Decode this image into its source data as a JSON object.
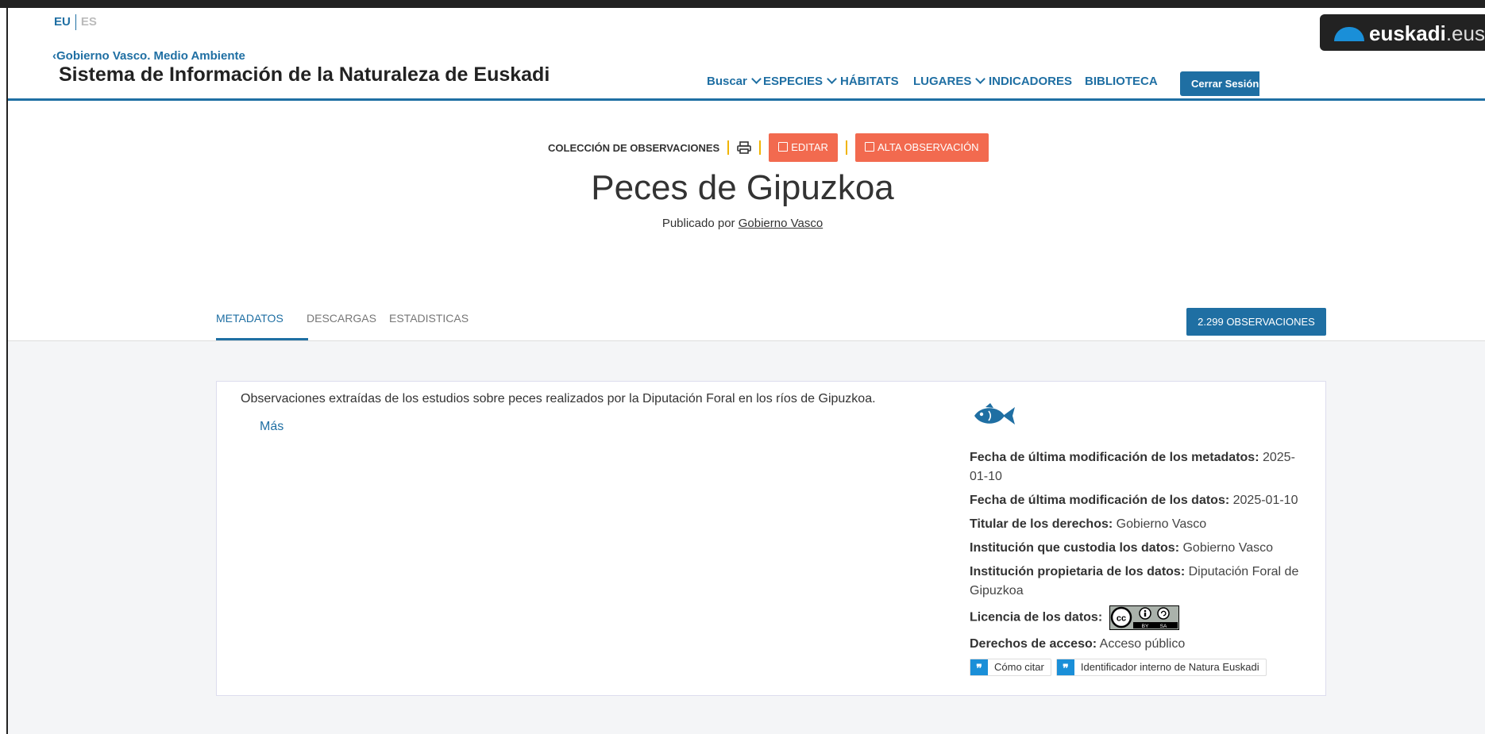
{
  "header": {
    "lang_eu": "EU",
    "lang_es": "ES",
    "gov_link": "Gobierno Vasco. Medio Ambiente",
    "site_title": "Sistema de Información de la Naturaleza de Euskadi",
    "brand_bold": "euskadi",
    "brand_light": ".eus",
    "nav": {
      "buscar": "Buscar",
      "especies": "ESPECIES",
      "habitats": "HÁBITATS",
      "lugares": "LUGARES",
      "indicadores": "INDICADORES",
      "biblioteca": "BIBLIOTECA"
    },
    "logout": "Cerrar Sesión"
  },
  "actions": {
    "collection_label": "COLECCIÓN DE OBSERVACIONES",
    "edit": "EDITAR",
    "new_observation": "ALTA OBSERVACIÓN"
  },
  "page": {
    "title": "Peces de Gipuzkoa",
    "published_by_label": "Publicado por",
    "publisher": "Gobierno Vasco"
  },
  "tabs": [
    "METADATOS",
    "DESCARGAS",
    "ESTADISTICAS"
  ],
  "active_tab": 0,
  "observations_button": "2.299 OBSERVACIONES",
  "card": {
    "description": "Observaciones extraídas de los estudios sobre peces realizados por la Diputación Foral en los ríos de Gipuzkoa.",
    "more": "Más",
    "meta": {
      "metadata_mod_label": "Fecha de última modificación de los metadatos:",
      "metadata_mod_value": "2025-01-10",
      "data_mod_label": "Fecha de última modificación de los datos:",
      "data_mod_value": "2025-01-10",
      "rights_holder_label": "Titular de los derechos:",
      "rights_holder_value": "Gobierno Vasco",
      "custodian_label": "Institución que custodia los datos:",
      "custodian_value": "Gobierno Vasco",
      "owner_label": "Institución propietaria de los datos:",
      "owner_value": "Diputación Foral de Gipuzkoa",
      "license_label": "Licencia de los datos:",
      "license_badge_by": "BY",
      "license_badge_sa": "SA",
      "access_label": "Derechos de acceso:",
      "access_value": "Acceso público"
    },
    "cite_how": "Cómo citar",
    "internal_id": "Identificador interno de Natura Euskadi"
  },
  "colors": {
    "primary": "#1f6fa3",
    "action_red": "#f26a4f",
    "separator_yellow": "#f0b400",
    "quote_blue": "#1a8fd8"
  }
}
